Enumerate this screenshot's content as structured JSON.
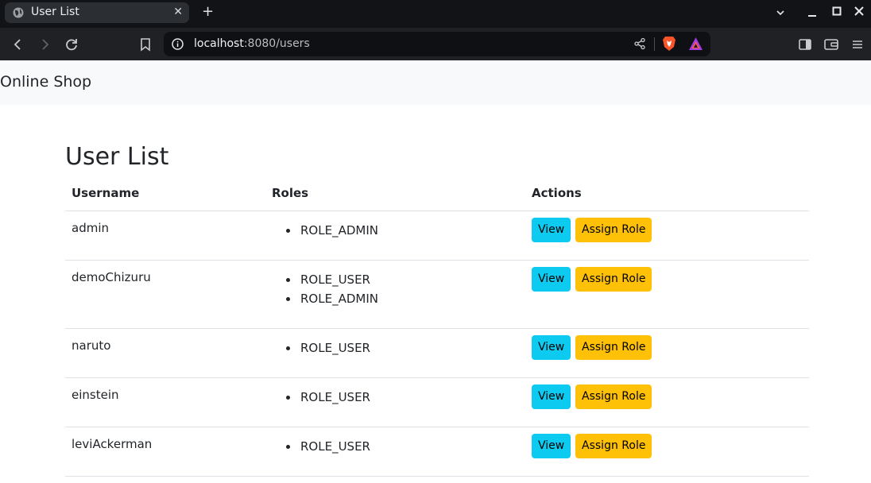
{
  "browser": {
    "tab_title": "User List",
    "tab_close": "✕",
    "new_tab": "+",
    "url_host": "localhost",
    "url_rest": ":8080/users"
  },
  "navbar": {
    "brand": "Online Shop"
  },
  "page": {
    "title": "User List",
    "columns": {
      "username": "Username",
      "roles": "Roles",
      "actions": "Actions"
    },
    "view_label": "View",
    "assign_label": "Assign Role",
    "users": [
      {
        "username": "admin",
        "roles": [
          "ROLE_ADMIN"
        ]
      },
      {
        "username": "demoChizuru",
        "roles": [
          "ROLE_USER",
          "ROLE_ADMIN"
        ]
      },
      {
        "username": "naruto",
        "roles": [
          "ROLE_USER"
        ]
      },
      {
        "username": "einstein",
        "roles": [
          "ROLE_USER"
        ]
      },
      {
        "username": "leviAckerman",
        "roles": [
          "ROLE_USER"
        ]
      }
    ]
  },
  "colors": {
    "view_button": "#0dcaf0",
    "assign_button": "#ffc107",
    "navbar_bg": "#f8f9fa"
  },
  "icons": [
    "globe-icon",
    "back-icon",
    "forward-icon",
    "reload-icon",
    "bookmark-icon",
    "info-icon",
    "share-icon",
    "brave-icon",
    "rewards-icon",
    "sidebar-icon",
    "wallet-icon",
    "menu-icon"
  ]
}
